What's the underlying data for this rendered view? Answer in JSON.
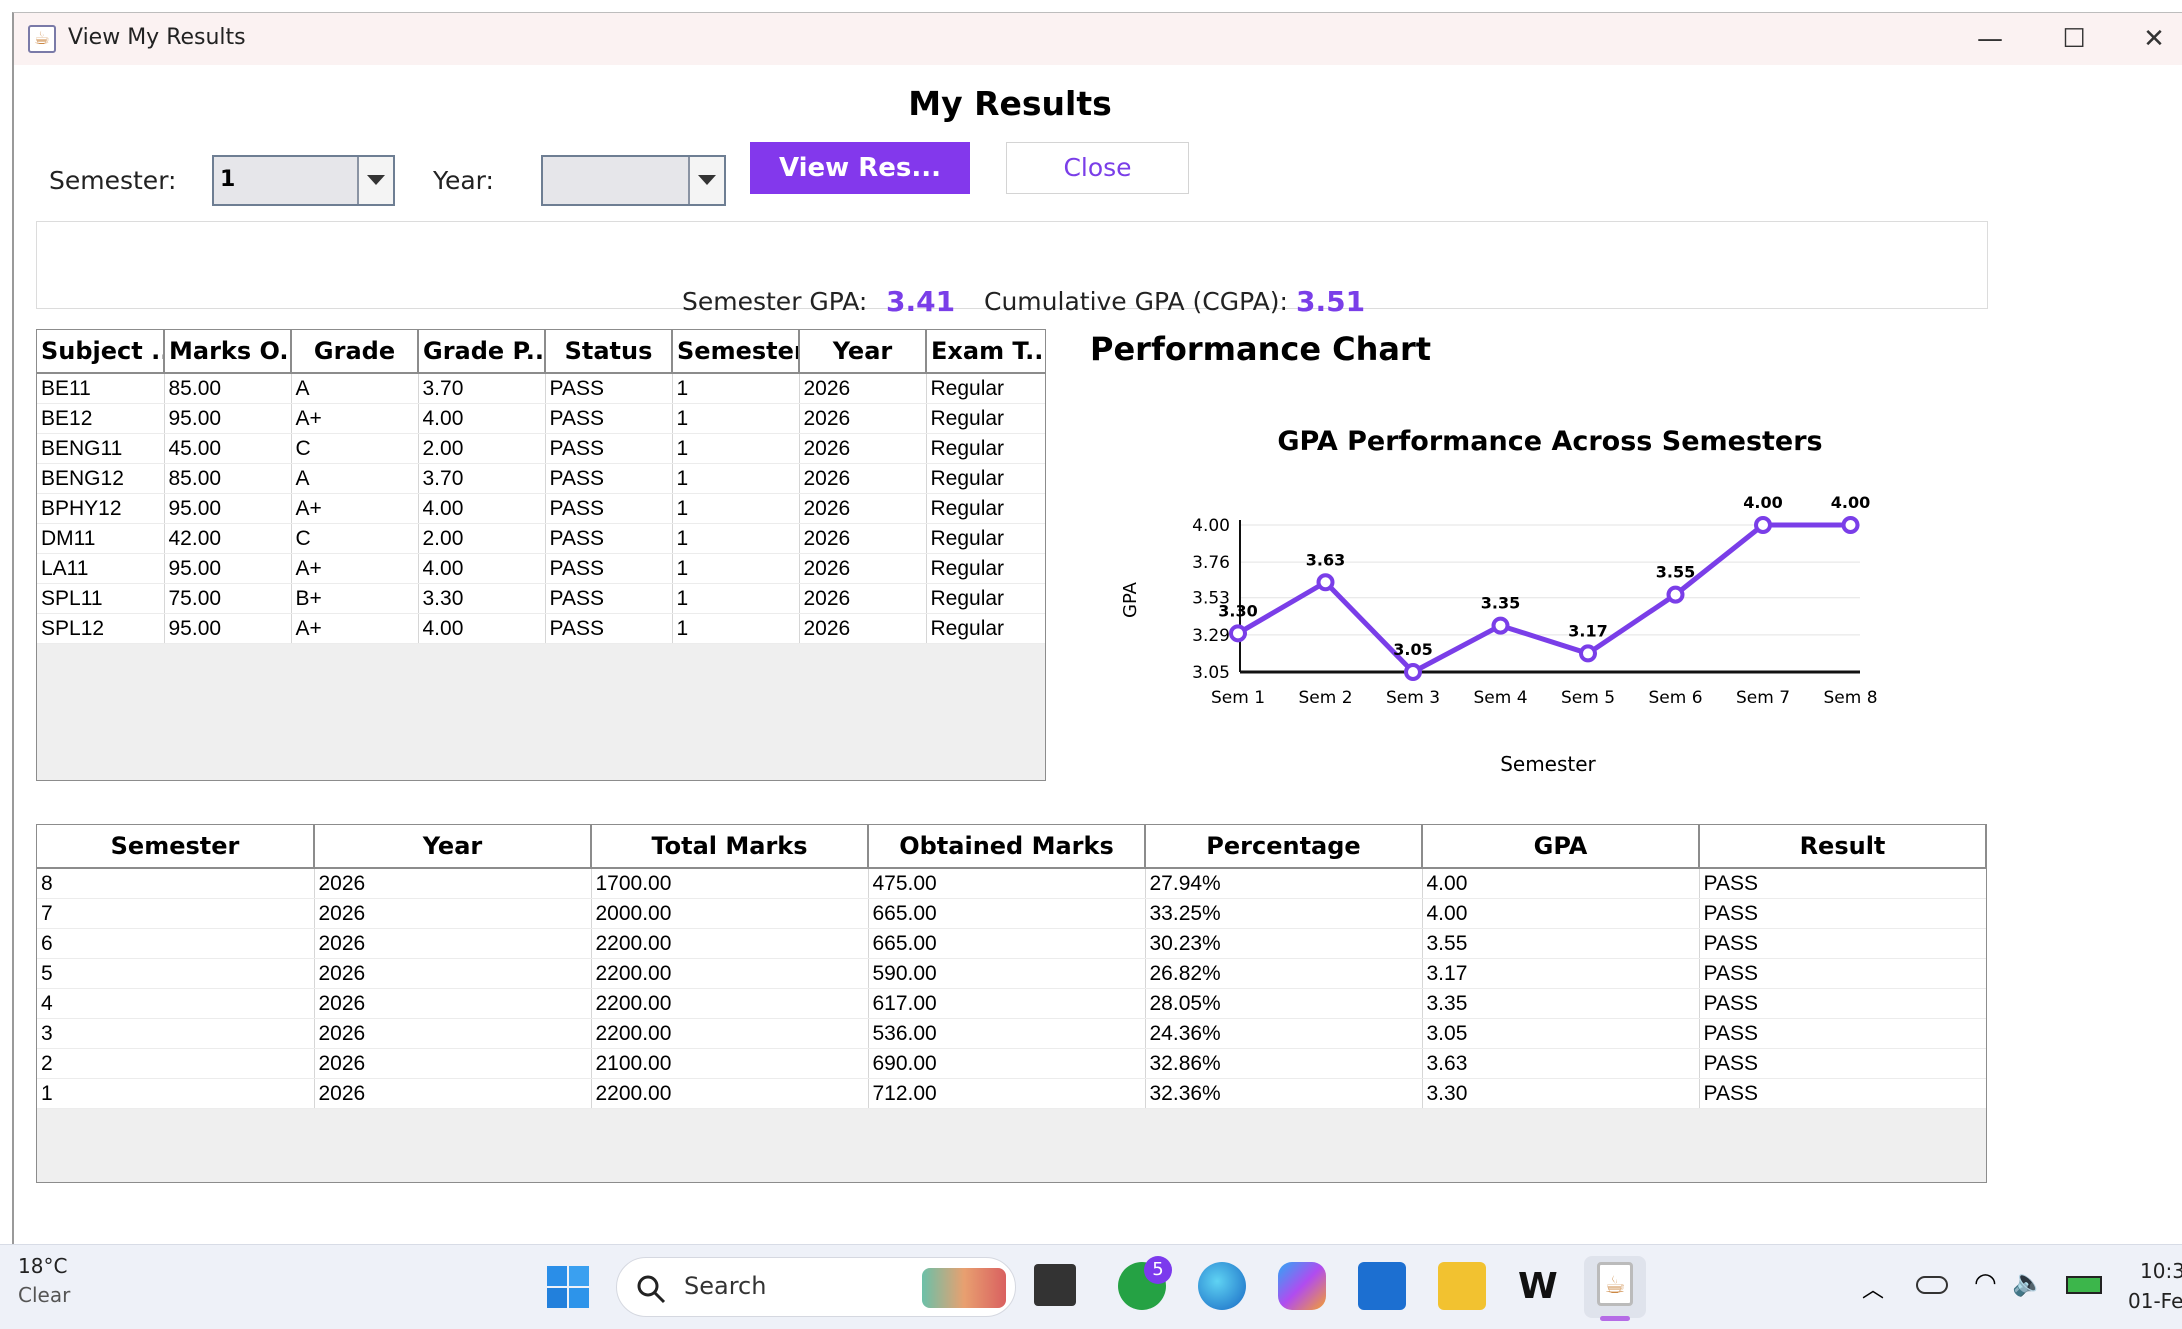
{
  "window": {
    "title": "View My Results",
    "minimize_glyph": "—",
    "maximize_glyph": "☐",
    "close_glyph": "✕"
  },
  "page": {
    "title": "My Results"
  },
  "filters": {
    "semester_label": "Semester:",
    "semester_value": "1",
    "year_label": "Year:",
    "year_value": ""
  },
  "buttons": {
    "view_results": "View Res...",
    "close": "Close"
  },
  "gpa": {
    "semester_label": "Semester GPA:",
    "semester_value": "3.41",
    "cumulative_label": "Cumulative GPA (CGPA):",
    "cumulative_value": "3.51",
    "accent_color": "#7a3ee8"
  },
  "subject_table": {
    "headers": [
      "Subject ...",
      "Marks O...",
      "Grade",
      "Grade P...",
      "Status",
      "Semester",
      "Year",
      "Exam T..."
    ],
    "rows": [
      [
        "BE11",
        "85.00",
        "A",
        "3.70",
        "PASS",
        "1",
        "2026",
        "Regular"
      ],
      [
        "BE12",
        "95.00",
        "A+",
        "4.00",
        "PASS",
        "1",
        "2026",
        "Regular"
      ],
      [
        "BENG11",
        "45.00",
        "C",
        "2.00",
        "PASS",
        "1",
        "2026",
        "Regular"
      ],
      [
        "BENG12",
        "85.00",
        "A",
        "3.70",
        "PASS",
        "1",
        "2026",
        "Regular"
      ],
      [
        "BPHY12",
        "95.00",
        "A+",
        "4.00",
        "PASS",
        "1",
        "2026",
        "Regular"
      ],
      [
        "DM11",
        "42.00",
        "C",
        "2.00",
        "PASS",
        "1",
        "2026",
        "Regular"
      ],
      [
        "LA11",
        "95.00",
        "A+",
        "4.00",
        "PASS",
        "1",
        "2026",
        "Regular"
      ],
      [
        "SPL11",
        "75.00",
        "B+",
        "3.30",
        "PASS",
        "1",
        "2026",
        "Regular"
      ],
      [
        "SPL12",
        "95.00",
        "A+",
        "4.00",
        "PASS",
        "1",
        "2026",
        "Regular"
      ]
    ]
  },
  "performance": {
    "heading": "Performance Chart"
  },
  "chart_data": {
    "type": "line",
    "title": "GPA Performance Across Semesters",
    "xlabel": "Semester",
    "ylabel": "GPA",
    "categories": [
      "Sem 1",
      "Sem 2",
      "Sem 3",
      "Sem 4",
      "Sem 5",
      "Sem 6",
      "Sem 7",
      "Sem 8"
    ],
    "values": [
      3.3,
      3.63,
      3.05,
      3.35,
      3.17,
      3.55,
      4.0,
      4.0
    ],
    "data_labels": [
      "3.30",
      "3.63",
      "3.05",
      "3.35",
      "3.17",
      "3.55",
      "4.00",
      "4.00"
    ],
    "yticks": [
      "3.05",
      "3.29",
      "3.53",
      "3.76",
      "4.00"
    ],
    "ylim": [
      3.05,
      4.0
    ],
    "grid": true,
    "legend": "none",
    "line_color": "#7a3ee8"
  },
  "semester_table": {
    "headers": [
      "Semester",
      "Year",
      "Total Marks",
      "Obtained Marks",
      "Percentage",
      "GPA",
      "Result"
    ],
    "rows": [
      [
        "8",
        "2026",
        "1700.00",
        "475.00",
        "27.94%",
        "4.00",
        "PASS"
      ],
      [
        "7",
        "2026",
        "2000.00",
        "665.00",
        "33.25%",
        "4.00",
        "PASS"
      ],
      [
        "6",
        "2026",
        "2200.00",
        "665.00",
        "30.23%",
        "3.55",
        "PASS"
      ],
      [
        "5",
        "2026",
        "2200.00",
        "590.00",
        "26.82%",
        "3.17",
        "PASS"
      ],
      [
        "4",
        "2026",
        "2200.00",
        "617.00",
        "28.05%",
        "3.35",
        "PASS"
      ],
      [
        "3",
        "2026",
        "2200.00",
        "536.00",
        "24.36%",
        "3.05",
        "PASS"
      ],
      [
        "2",
        "2026",
        "2100.00",
        "690.00",
        "32.86%",
        "3.63",
        "PASS"
      ],
      [
        "1",
        "2026",
        "2200.00",
        "712.00",
        "32.36%",
        "3.30",
        "PASS"
      ]
    ]
  },
  "taskbar": {
    "weather_temp": "18°C",
    "weather_condition": "Clear",
    "search_placeholder": "Search",
    "whatsapp_badge": "5",
    "clock_time": "10:3",
    "clock_date": "01-Fe"
  }
}
